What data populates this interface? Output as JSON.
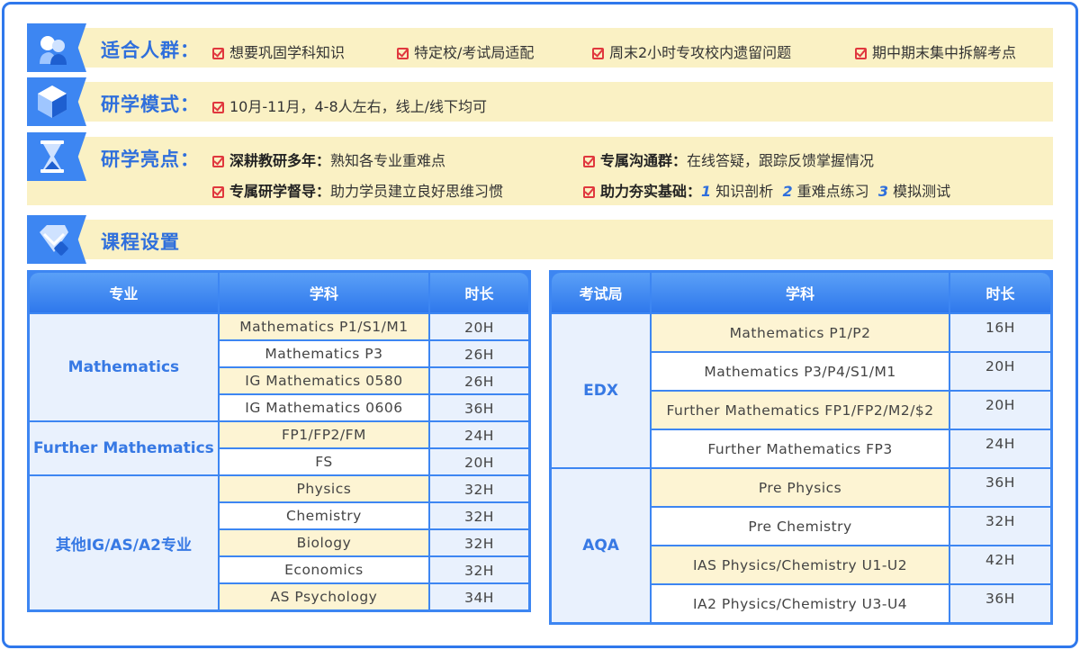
{
  "audience": {
    "title": "适合人群：",
    "items": [
      "想要巩固学科知识",
      "特定校/考试局适配",
      "周末2小时专攻校内遗留问题",
      "期中期末集中拆解考点"
    ]
  },
  "mode": {
    "title": "研学模式：",
    "text": "10月-11月，4-8人左右，线上/线下均可"
  },
  "highlights": {
    "title": "研学亮点：",
    "items": [
      {
        "label": "深耕教研多年：",
        "text": "熟知各专业重难点"
      },
      {
        "label": "专属沟通群：",
        "text": "在线答疑，跟踪反馈掌握情况"
      },
      {
        "label": "专属研学督导：",
        "text": "助力学员建立良好思维习惯"
      },
      {
        "label": "助力夯实基础：",
        "parts": [
          {
            "num": "1",
            "text": "知识剖析"
          },
          {
            "num": "2",
            "text": "重难点练习"
          },
          {
            "num": "3",
            "text": "模拟测试"
          }
        ]
      }
    ]
  },
  "course": {
    "title": "课程设置"
  },
  "table_left": {
    "headers": [
      "专业",
      "学科",
      "时长"
    ],
    "groups": [
      {
        "name": "Mathematics",
        "rows": [
          {
            "subject": "Mathematics P1/S1/M1",
            "hours": "20H"
          },
          {
            "subject": "Mathematics P3",
            "hours": "26H"
          },
          {
            "subject": "IG Mathematics 0580",
            "hours": "26H"
          },
          {
            "subject": "IG Mathematics 0606",
            "hours": "36H"
          }
        ]
      },
      {
        "name": "Further Mathematics",
        "rows": [
          {
            "subject": "FP1/FP2/FM",
            "hours": "24H"
          },
          {
            "subject": "FS",
            "hours": "20H"
          }
        ]
      },
      {
        "name": "其他IG/AS/A2专业",
        "rows": [
          {
            "subject": "Physics",
            "hours": "32H"
          },
          {
            "subject": "Chemistry",
            "hours": "32H"
          },
          {
            "subject": "Biology",
            "hours": "32H"
          },
          {
            "subject": "Economics",
            "hours": "32H"
          },
          {
            "subject": "AS Psychology",
            "hours": "34H"
          }
        ]
      }
    ]
  },
  "table_right": {
    "headers": [
      "考试局",
      "学科",
      "时长"
    ],
    "groups": [
      {
        "name": "EDX",
        "rows": [
          {
            "subject": "Mathematics P1/P2",
            "hours": "16H"
          },
          {
            "subject": "Mathematics P3/P4/S1/M1",
            "hours": "20H"
          },
          {
            "subject": "Further Mathematics FP1/FP2/M2/$2",
            "hours": "20H"
          },
          {
            "subject": "Further Mathematics FP3",
            "hours": "24H"
          }
        ]
      },
      {
        "name": "AQA",
        "rows": [
          {
            "subject": "Pre Physics",
            "hours": "36H"
          },
          {
            "subject": "Pre Chemistry",
            "hours": "32H"
          },
          {
            "subject": "IAS Physics/Chemistry U1-U2",
            "hours": "42H"
          },
          {
            "subject": "IA2 Physics/Chemistry U3-U4",
            "hours": "36H"
          }
        ]
      }
    ]
  }
}
